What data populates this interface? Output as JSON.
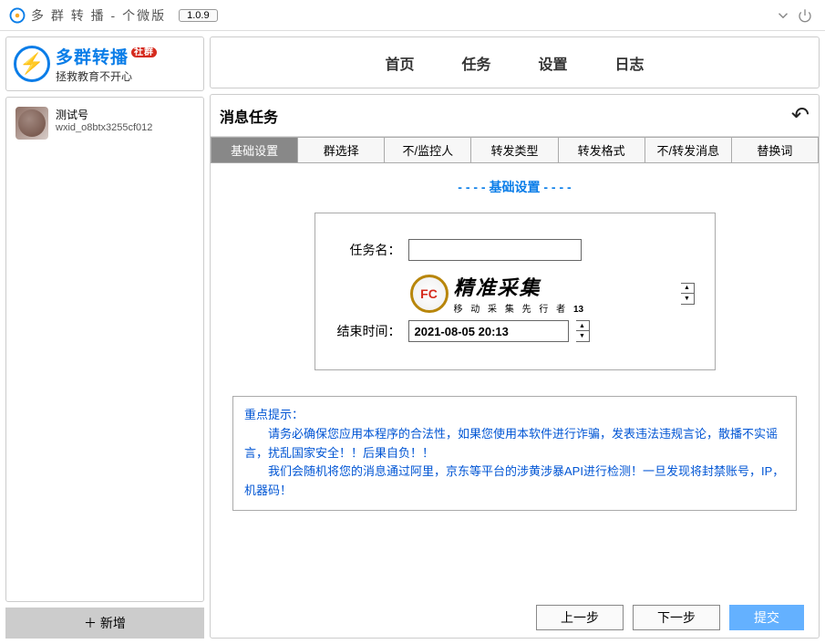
{
  "titlebar": {
    "title": "多 群 转 播 - 个微版",
    "version": "1.0.9"
  },
  "brand": {
    "name": "多群转播",
    "tag": "社群",
    "slogan": "拯救教育不开心"
  },
  "account": {
    "name": "测试号",
    "wxid": "wxid_o8btx3255cf012"
  },
  "sidebar": {
    "add": "＋ 新增"
  },
  "nav": [
    "首页",
    "任务",
    "设置",
    "日志"
  ],
  "panel": {
    "title": "消息任务"
  },
  "tabs": [
    "基础设置",
    "群选择",
    "不/监控人",
    "转发类型",
    "转发格式",
    "不/转发消息",
    "替换词"
  ],
  "section": {
    "title": "- - - - 基础设置 - - - -"
  },
  "form": {
    "task_label": "任务名：",
    "task_value": "",
    "end_label": "结束时间：",
    "end_value": "2021-08-05 20:13",
    "inline_suffix": "13"
  },
  "watermark": {
    "clock": "FC",
    "line1": "精准采集",
    "line2": "移 动 采 集 先 行 者"
  },
  "notice": {
    "head": "重点提示：",
    "p1": "　　请务必确保您应用本程序的合法性，如果您使用本软件进行诈骗，发表违法违规言论，散播不实谣言，扰乱国家安全！！后果自负！！",
    "p2": "　　我们会随机将您的消息通过阿里，京东等平台的涉黄涉暴API进行检测！一旦发现将封禁账号，IP，机器码！"
  },
  "footer": {
    "prev": "上一步",
    "next": "下一步",
    "submit": "提交"
  }
}
